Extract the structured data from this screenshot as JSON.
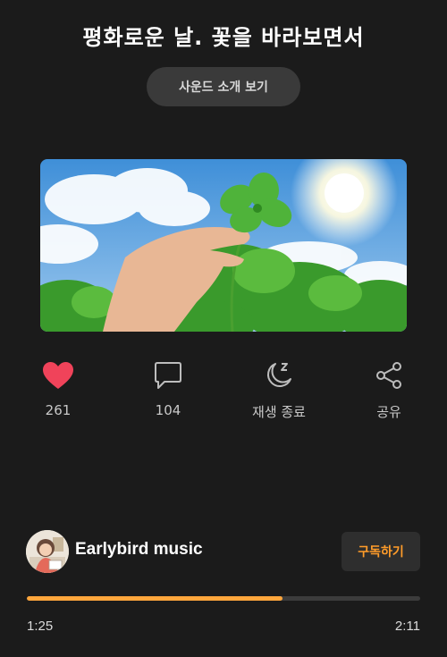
{
  "title": "평화로운 날. 꽃을 바라보면서",
  "intro_button": "사운드 소개 보기",
  "actions": {
    "like": {
      "count": "261",
      "icon": "heart-icon",
      "color": "#f0435a"
    },
    "comment": {
      "count": "104",
      "icon": "comment-icon"
    },
    "sleep": {
      "label": "재생 종료",
      "icon": "moon-sleep-icon"
    },
    "share": {
      "label": "공유",
      "icon": "share-icon"
    }
  },
  "channel": {
    "name": "Earlybird music",
    "subscribe_label": "구독하기",
    "subscribe_color": "#ff9c2a"
  },
  "player": {
    "current_time": "1:25",
    "total_time": "2:11",
    "progress": 0.65,
    "progress_color": "#ffa63c"
  }
}
